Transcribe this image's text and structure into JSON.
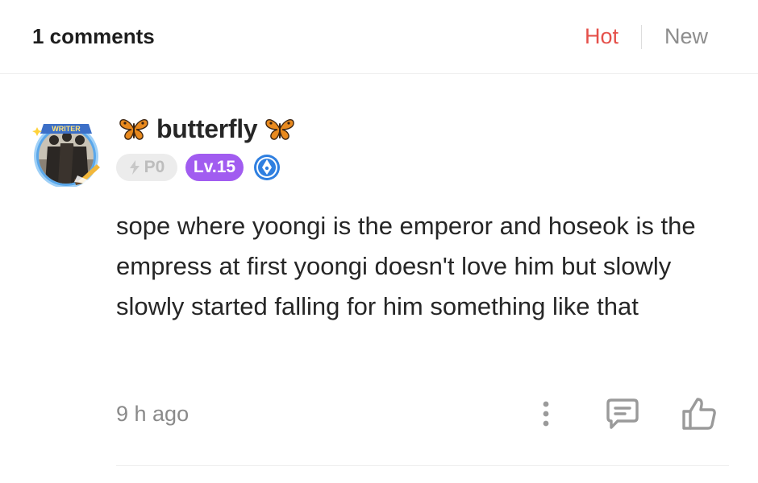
{
  "header": {
    "count_label": "1 comments",
    "sort_hot": "Hot",
    "sort_new": "New"
  },
  "comment": {
    "avatar_badge": "WRITER",
    "username": "butterfly",
    "username_prefix_icon": "butterfly-icon",
    "username_suffix_icon": "butterfly-icon",
    "points_badge": "P0",
    "level_badge": "Lv.15",
    "writer_badge_icon": "pen-nib-icon",
    "text": "sope where yoongi is the emperor and hoseok is the empress at first yoongi doesn't love him but slowly slowly started falling for him something like that",
    "time": "9 h ago",
    "actions": {
      "more_icon": "vertical-dots-icon",
      "reply_icon": "comment-bubble-icon",
      "like_icon": "thumbs-up-icon"
    }
  },
  "colors": {
    "hot": "#e5504a",
    "new": "#8d8d8d",
    "level_badge": "#a15cf0",
    "writer_badge": "#2f7fe0"
  }
}
